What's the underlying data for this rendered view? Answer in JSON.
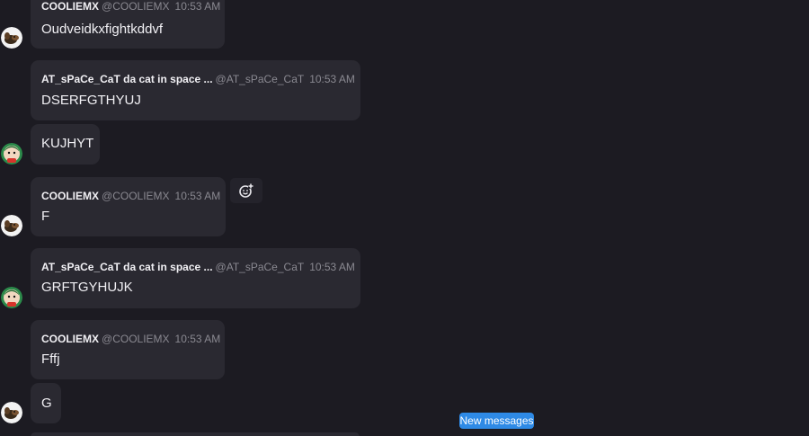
{
  "messages": [
    {
      "author": "COOLIEMX",
      "handle": "@COOLIEMX",
      "time": "10:53 AM",
      "text": "Oudveidkxfightkddvf",
      "avatar_icon": "dog-avatar-icon"
    },
    {
      "author": "AT_sPaCe_CaT da cat in space ...",
      "handle": "@AT_sPaCe_CaT",
      "time": "10:53 AM",
      "text": "DSERFGTHYUJ",
      "avatar_icon": "character-avatar-icon"
    },
    {
      "text": "KUJHYT",
      "avatar_icon": "character-avatar-icon"
    },
    {
      "author": "COOLIEMX",
      "handle": "@COOLIEMX",
      "time": "10:53 AM",
      "text": "F",
      "avatar_icon": "dog-avatar-icon"
    },
    {
      "author": "AT_sPaCe_CaT da cat in space ...",
      "handle": "@AT_sPaCe_CaT",
      "time": "10:53 AM",
      "text": "GRFTGYHUJK",
      "avatar_icon": "character-avatar-icon"
    },
    {
      "author": "COOLIEMX",
      "handle": "@COOLIEMX",
      "time": "10:53 AM",
      "text": "Fffj",
      "avatar_icon": "dog-avatar-icon"
    },
    {
      "text": "G",
      "avatar_icon": "dog-avatar-icon"
    }
  ],
  "new_messages_label": "New messages",
  "add_reaction_icon": "add-reaction-icon",
  "colors": {
    "background": "#1c1b22",
    "bubble": "#2a2931",
    "accent": "#2e8ae6",
    "muted_text": "#8a8991"
  }
}
